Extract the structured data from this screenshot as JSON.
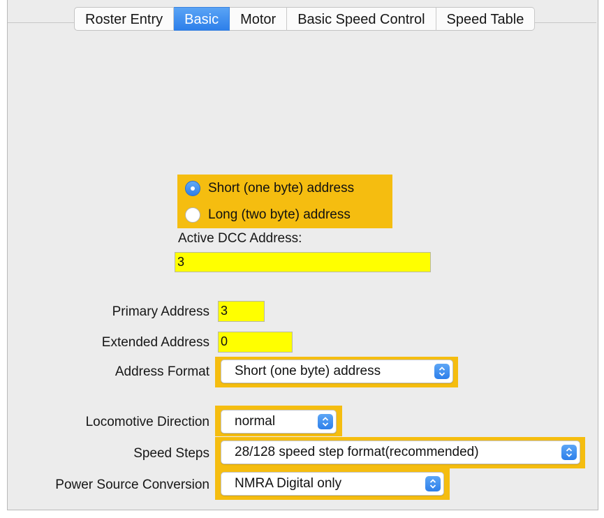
{
  "tabs": [
    {
      "label": "Roster Entry",
      "active": false
    },
    {
      "label": "Basic",
      "active": true
    },
    {
      "label": "Motor",
      "active": false
    },
    {
      "label": "Basic Speed Control",
      "active": false
    },
    {
      "label": "Speed Table",
      "active": false
    }
  ],
  "address_mode": {
    "options": [
      {
        "label": "Short (one byte) address",
        "selected": true
      },
      {
        "label": "Long (two byte) address",
        "selected": false
      }
    ]
  },
  "active_dcc": {
    "label": "Active DCC Address:",
    "value": "3"
  },
  "primary": {
    "label": "Primary Address",
    "value": "3"
  },
  "extended": {
    "label": "Extended Address",
    "value": "0"
  },
  "address_format": {
    "label": "Address Format",
    "value": "Short (one byte) address"
  },
  "direction": {
    "label": "Locomotive Direction",
    "value": "normal"
  },
  "speed_steps": {
    "label": "Speed Steps",
    "value": "28/128 speed step format(recommended)"
  },
  "power_source": {
    "label": "Power Source Conversion",
    "value": "NMRA Digital only"
  },
  "colors": {
    "highlight": "#f5bd10",
    "field": "#ffff00",
    "accent": "#2d7fea",
    "panel": "#ececec"
  }
}
